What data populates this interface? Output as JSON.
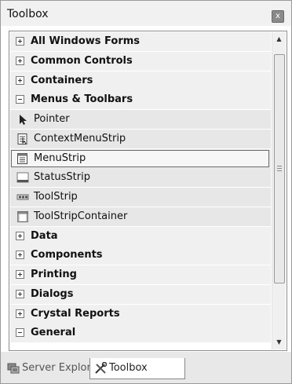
{
  "window": {
    "title": "Toolbox",
    "close_glyph": "x"
  },
  "rows": [
    {
      "type": "category",
      "label": "All Windows Forms",
      "expanded": false
    },
    {
      "type": "category",
      "label": "Common Controls",
      "expanded": false
    },
    {
      "type": "category",
      "label": "Containers",
      "expanded": false
    },
    {
      "type": "category",
      "label": "Menus & Toolbars",
      "expanded": true
    },
    {
      "type": "item",
      "label": "Pointer",
      "icon": "pointer-icon"
    },
    {
      "type": "item",
      "label": "ContextMenuStrip",
      "icon": "context-menu-strip-icon"
    },
    {
      "type": "item",
      "label": "MenuStrip",
      "icon": "menu-strip-icon",
      "selected": true
    },
    {
      "type": "item",
      "label": "StatusStrip",
      "icon": "status-strip-icon"
    },
    {
      "type": "item",
      "label": "ToolStrip",
      "icon": "tool-strip-icon"
    },
    {
      "type": "item",
      "label": "ToolStripContainer",
      "icon": "tool-strip-container-icon"
    },
    {
      "type": "category",
      "label": "Data",
      "expanded": false
    },
    {
      "type": "category",
      "label": "Components",
      "expanded": false
    },
    {
      "type": "category",
      "label": "Printing",
      "expanded": false
    },
    {
      "type": "category",
      "label": "Dialogs",
      "expanded": false
    },
    {
      "type": "category",
      "label": "Crystal Reports",
      "expanded": false
    },
    {
      "type": "category",
      "label": "General",
      "expanded": true
    }
  ],
  "scrollbar": {
    "up_glyph": "▲",
    "down_glyph": "▼"
  },
  "tabs": [
    {
      "label": "Server Explorer",
      "icon": "server-explorer-icon",
      "active": false
    },
    {
      "label": "Toolbox",
      "icon": "toolbox-icon",
      "active": true
    }
  ]
}
